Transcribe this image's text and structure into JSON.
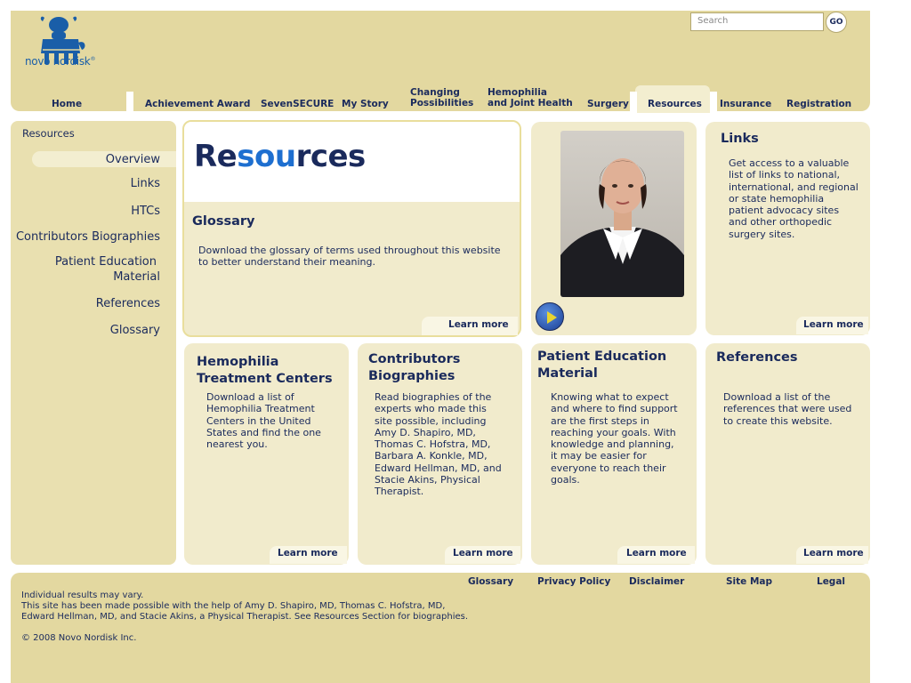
{
  "brand": {
    "name": "novo nordisk",
    "trademark": "®"
  },
  "search": {
    "placeholder": "Search",
    "go_label": "GO"
  },
  "nav": {
    "home": "Home",
    "achievement": "Achievement Award",
    "sevensecure": "SevenSECURE",
    "mystory": "My Story",
    "changing_1": "Changing",
    "changing_2": "Possibilities",
    "hemo_1": "Hemophilia",
    "hemo_2": "and Joint Health",
    "surgery": "Surgery",
    "resources": "Resources",
    "insurance": "Insurance",
    "registration": "Registration"
  },
  "sidebar": {
    "title": "Resources",
    "overview": "Overview",
    "links": "Links",
    "htcs": "HTCs",
    "contributors": "Contributors Biographies",
    "patient_1": "Patient Education",
    "patient_2": "Material",
    "references": "References",
    "glossary": "Glossary"
  },
  "main": {
    "title_a": "Re",
    "title_b": "sou",
    "title_c": "rces",
    "learn_more": "Learn more",
    "glossary": {
      "title": "Glossary",
      "line1": "Download the glossary of terms used throughout this website",
      "line2": "to better understand their meaning."
    },
    "links": {
      "title": "Links",
      "lines": [
        "Get access to a valuable",
        "list of links to national,",
        "international, and regional",
        "or state hemophilia",
        "patient advocacy sites",
        "and other orthopedic",
        "surgery sites."
      ]
    },
    "htc": {
      "title_1": "Hemophilia",
      "title_2": "Treatment Centers",
      "lines": [
        "Download a list of",
        "Hemophilia Treatment",
        "Centers in the United",
        "States and find the one",
        "nearest you."
      ]
    },
    "contrib": {
      "title_1": "Contributors",
      "title_2": "Biographies",
      "lines": [
        "Read biographies of the",
        "experts who made this",
        "site possible, including",
        "Amy D. Shapiro, MD,",
        "Thomas C. Hofstra, MD,",
        "Barbara A. Konkle, MD,",
        "Edward Hellman, MD, and",
        "Stacie Akins,  Physical",
        "Therapist."
      ]
    },
    "patient": {
      "title_1": "Patient Education",
      "title_2": "Material",
      "lines": [
        "Knowing what to expect",
        "and where to find support",
        "are the first steps in",
        "reaching your goals. With",
        "knowledge and planning,",
        "it may be easier for",
        "everyone to reach their",
        "goals."
      ]
    },
    "refs": {
      "title": "References",
      "lines": [
        "Download a list of the",
        "references that were used",
        "to create this website."
      ]
    }
  },
  "footer": {
    "glossary": "Glossary",
    "privacy": "Privacy Policy",
    "disclaimer": "Disclaimer",
    "sitemap": "Site Map",
    "legal": "Legal",
    "line1": "Individual results may vary.",
    "line2": "This site has been made possible with the help of Amy D. Shapiro, MD, Thomas C. Hofstra, MD,",
    "line3": "Edward Hellman, MD, and Stacie Akins, a Physical Therapist. See Resources Section for biographies.",
    "copyright": "© 2008 Novo Nordisk Inc."
  },
  "colors": {
    "accent": "#1e6fd0",
    "navy": "#1a2a5c",
    "khaki": "#e3d8a0",
    "card": "#f1ebcc"
  }
}
